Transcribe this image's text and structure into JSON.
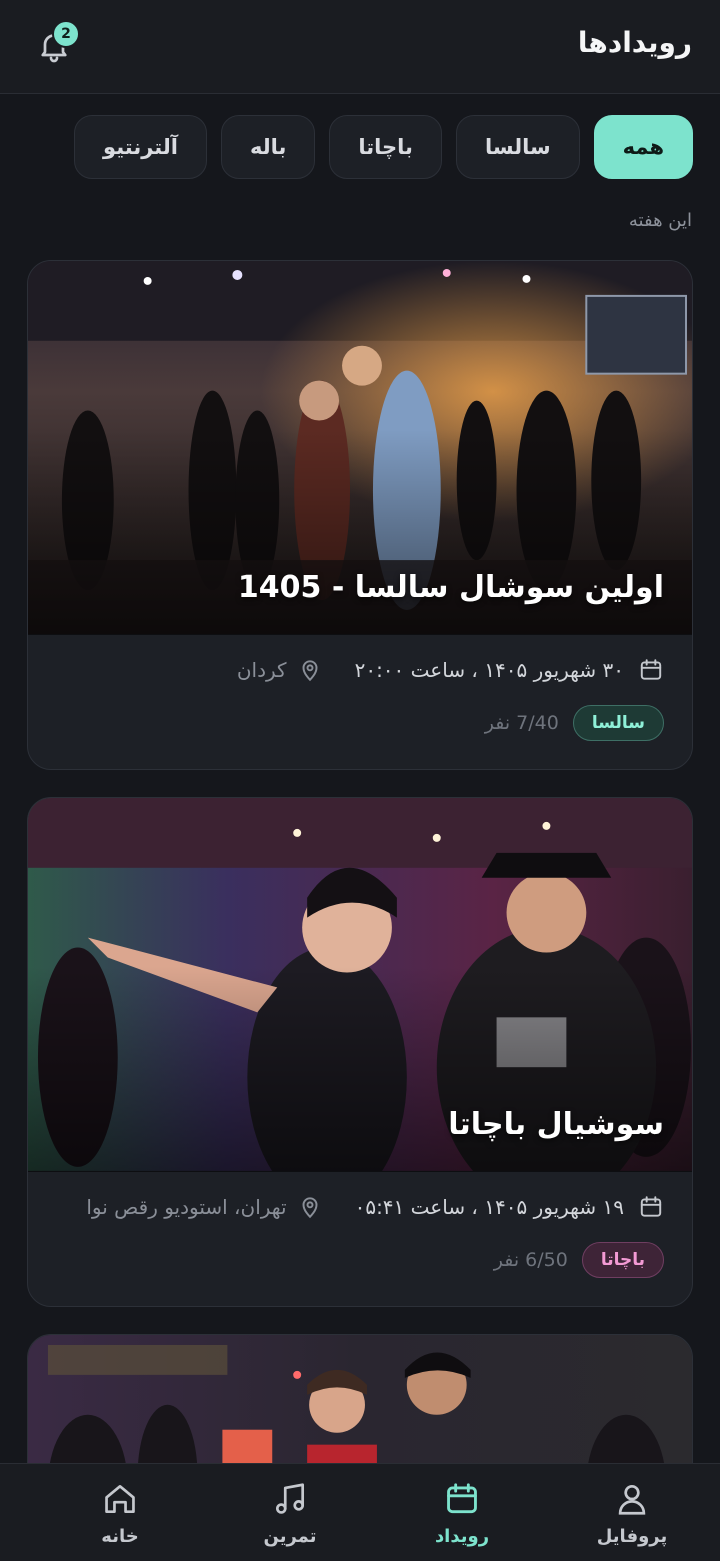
{
  "header": {
    "title": "رویدادها",
    "notification_count": "2"
  },
  "filters": [
    {
      "label": "همه",
      "active": true
    },
    {
      "label": "سالسا",
      "active": false
    },
    {
      "label": "باچاتا",
      "active": false
    },
    {
      "label": "باله",
      "active": false
    },
    {
      "label": "آلترنتیو",
      "active": false
    }
  ],
  "section_label": "این هفته",
  "events": [
    {
      "title": "اولین سوشال سالسا - 1405",
      "datetime": "۳۰ شهریور ۱۴۰۵ ، ساعت ۲۰:۰۰",
      "location": "کردان",
      "tag": "سالسا",
      "capacity": "7/40 نفر"
    },
    {
      "title": "سوشیال باچاتا",
      "datetime": "۱۹ شهریور ۱۴۰۵ ، ساعت ۰۵:۴۱",
      "location": "تهران، استودیو رقص نوا",
      "tag": "باچاتا",
      "capacity": "6/50 نفر"
    }
  ],
  "nav": {
    "home": "خانه",
    "practice": "تمرین",
    "events": "رویداد",
    "profile": "پروفایل"
  },
  "colors": {
    "accent": "#7de3cd",
    "background": "#15171c",
    "card": "#1d2026"
  }
}
